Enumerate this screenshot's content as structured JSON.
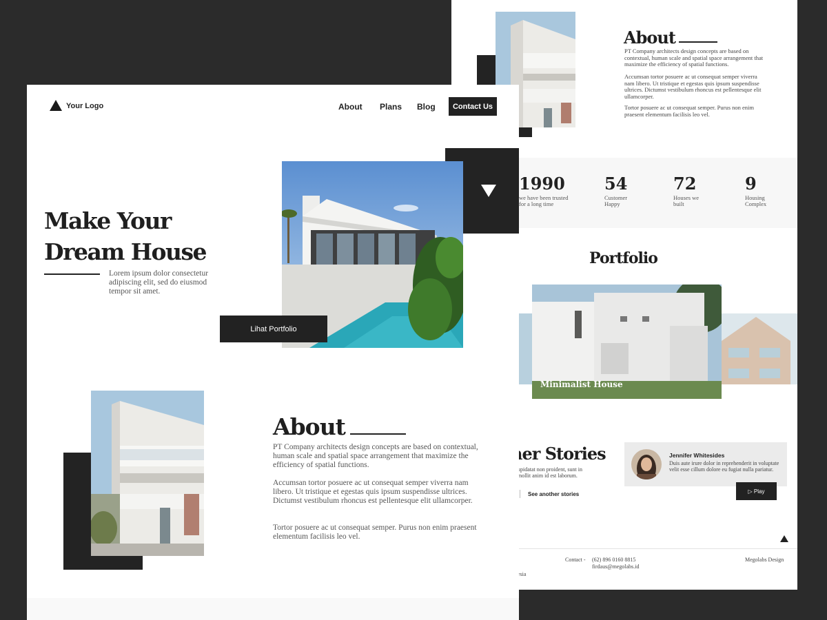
{
  "back": {
    "about": {
      "title": "About",
      "p1": "PT Company architects design concepts are based on contextual, human scale and spatial space arrangement that maximize the efficiency of spatial functions.",
      "p2": "Accumsan tortor posuere ac ut consequat semper viverra nam libero. Ut tristique et egestas quis ipsum suspendisse ultrices. Dictumst vestibulum rhoncus est pellentesque elit ullamcorper.",
      "p3": "Tortor posuere ac ut consequat semper. Purus non enim praesent elementum facilisis leo vel."
    },
    "stats": [
      {
        "number": "1990",
        "label": "we have been trusted for a long time"
      },
      {
        "number": "54",
        "label": "Customer Happy"
      },
      {
        "number": "72",
        "label": "Houses we built"
      },
      {
        "number": "9",
        "label": "Housing Complex"
      }
    ],
    "portfolio": {
      "title": "Portfolio",
      "caption": "Minimalist House"
    },
    "stories": {
      "title": "ner Stories",
      "text": "upidatat non proident, sunt in mollit anim id est laborum.",
      "see_another": "See another stories",
      "name": "Jennifer Whitesides",
      "quote": "Duis aute irure dolor in reprehenderit in voluptate velit esse cillum dolore eu fugiat nulla pariatur.",
      "play": "▷ Play"
    },
    "footer": {
      "col1_a": "l",
      "col1_b": "esia",
      "contact_label": "Contact -",
      "phone": "(62) 896 0160 8815",
      "email": "firdaus@megolabs.id",
      "brand": "Megolabs Design"
    }
  },
  "front": {
    "logo_text": "Your Logo",
    "nav": {
      "about": "About",
      "plans": "Plans",
      "blog": "Blog",
      "contact": "Contact Us"
    },
    "hero": {
      "title_line1": "Make Your",
      "title_line2": "Dream House",
      "subtitle": "Lorem ipsum dolor consectetur adipiscing elit, sed do eiusmod tempor sit amet.",
      "button": "Lihat Portfolio"
    },
    "about": {
      "title": "About",
      "p1": "PT Company architects design concepts are based on contextual, human scale and spatial space arrangement that maximize the efficiency of spatial functions.",
      "p2": "Accumsan tortor posuere ac ut consequat semper viverra nam libero. Ut tristique et egestas quis ipsum suspendisse ultrices. Dictumst vestibulum rhoncus est pellentesque elit ullamcorper.",
      "p3": "Tortor posuere ac ut consequat semper. Purus non enim praesent elementum facilisis leo vel."
    }
  },
  "colors": {
    "dark": "#232323",
    "background": "#2b2b2b",
    "page": "#ffffff",
    "sky": "#8fb4d6",
    "pool": "#2aa7b8"
  },
  "icons": [
    "logo-triangle-icon",
    "down-arrow-icon",
    "scroll-top-icon"
  ]
}
